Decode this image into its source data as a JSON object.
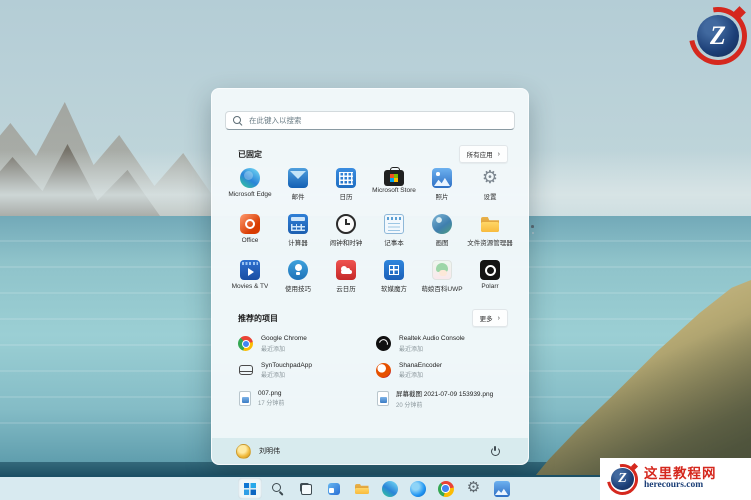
{
  "start_menu": {
    "search": {
      "placeholder": "在此键入以搜索"
    },
    "pinned": {
      "title": "已固定",
      "all_apps_label": "所有应用",
      "chevron": "›",
      "apps": [
        {
          "label": "Microsoft Edge",
          "icon": "edge"
        },
        {
          "label": "邮件",
          "icon": "mail"
        },
        {
          "label": "日历",
          "icon": "calendar"
        },
        {
          "label": "Microsoft Store",
          "icon": "store"
        },
        {
          "label": "照片",
          "icon": "photos"
        },
        {
          "label": "设置",
          "icon": "settings"
        },
        {
          "label": "Office",
          "icon": "office"
        },
        {
          "label": "计算器",
          "icon": "calculator"
        },
        {
          "label": "闹钟和时钟",
          "icon": "alarms-clock"
        },
        {
          "label": "记事本",
          "icon": "notepad"
        },
        {
          "label": "画图",
          "icon": "paint"
        },
        {
          "label": "文件资源管理器",
          "icon": "file-explorer"
        },
        {
          "label": "Movies & TV",
          "icon": "movies-tv"
        },
        {
          "label": "使用技巧",
          "icon": "tips"
        },
        {
          "label": "云日历",
          "icon": "cloud-calendar"
        },
        {
          "label": "软媒魔方",
          "icon": "ruanmei-mofang"
        },
        {
          "label": "萌娘百科UWP",
          "icon": "moegirl-uwp"
        },
        {
          "label": "Polarr",
          "icon": "polarr"
        }
      ]
    },
    "recommended": {
      "title": "推荐的项目",
      "more_label": "更多",
      "chevron": "›",
      "items": [
        {
          "title": "Google Chrome",
          "subtitle": "最近添加",
          "icon": "chrome"
        },
        {
          "title": "Realtek Audio Console",
          "subtitle": "最近添加",
          "icon": "realtek"
        },
        {
          "title": "SynTouchpadApp",
          "subtitle": "最近添加",
          "icon": "touchpad"
        },
        {
          "title": "ShanaEncoder",
          "subtitle": "最近添加",
          "icon": "shana-encoder"
        },
        {
          "title": "007.png",
          "subtitle": "17 分钟前",
          "icon": "image-file"
        },
        {
          "title": "屏幕截图 2021-07-09 153939.png",
          "subtitle": "20 分钟前",
          "icon": "image-file"
        }
      ]
    },
    "user": {
      "name": "刘明伟"
    }
  },
  "taskbar": {
    "buttons": [
      {
        "icon": "start"
      },
      {
        "icon": "search"
      },
      {
        "icon": "task-view"
      },
      {
        "icon": "widgets"
      },
      {
        "icon": "file-explorer"
      },
      {
        "icon": "edge"
      },
      {
        "icon": "browser"
      },
      {
        "icon": "chrome"
      },
      {
        "icon": "settings"
      },
      {
        "icon": "photos"
      }
    ]
  },
  "watermark": {
    "logo_letter": "Z",
    "title": "这里教程网",
    "url": "herecours.com"
  },
  "colors": {
    "accent_blue": "#0f78d7",
    "watermark_red": "#d5281e",
    "watermark_navy": "#1c3f77",
    "taskbar_bg": "#d8eaf0"
  }
}
